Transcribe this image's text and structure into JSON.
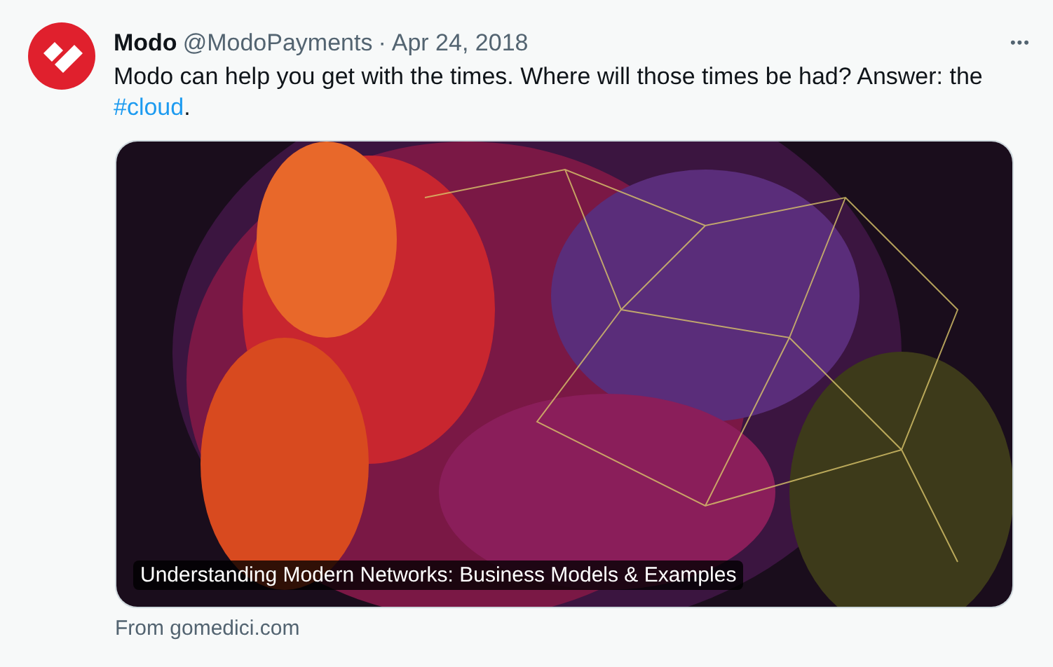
{
  "tweet": {
    "author_name": "Modo",
    "handle": "@ModoPayments",
    "separator": "·",
    "date": "Apr 24, 2018",
    "more": "•••",
    "text": "Modo can help you get with the times. Where will those times be had? Answer: the ",
    "hashtag": "#cloud",
    "text_end": ".",
    "card": {
      "kind": "picture",
      "caption": "Understanding Modern Networks: Business Models & Examples"
    },
    "source": "From gomedici.com"
  }
}
